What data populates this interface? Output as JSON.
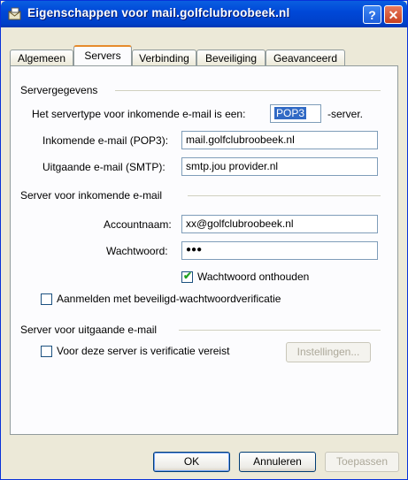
{
  "window": {
    "title": "Eigenschappen voor mail.golfclubroobeek.nl",
    "help_button": "?",
    "close_button": "✕"
  },
  "tabs": [
    {
      "label": "Algemeen",
      "active": false
    },
    {
      "label": "Servers",
      "active": true
    },
    {
      "label": "Verbinding",
      "active": false
    },
    {
      "label": "Beveiliging",
      "active": false
    },
    {
      "label": "Geavanceerd",
      "active": false
    }
  ],
  "server_info": {
    "group_title": "Servergegevens",
    "type_label_prefix": "Het servertype voor inkomende e-mail is een:",
    "type_value": "POP3",
    "type_label_suffix": "-server.",
    "incoming_label": "Inkomende e-mail (POP3):",
    "incoming_value": "mail.golfclubroobeek.nl",
    "outgoing_label": "Uitgaande e-mail (SMTP):",
    "outgoing_value": "smtp.jou provider.nl"
  },
  "incoming_server": {
    "group_title": "Server voor inkomende e-mail",
    "account_label": "Accountnaam:",
    "account_value": "xx@golfclubroobeek.nl",
    "password_label": "Wachtwoord:",
    "password_value": "●●●",
    "remember_label": "Wachtwoord onthouden",
    "remember_checked": true,
    "spa_label": "Aanmelden met beveiligd-wachtwoordverificatie",
    "spa_checked": false
  },
  "outgoing_server": {
    "group_title": "Server voor uitgaande e-mail",
    "auth_label": "Voor deze server is verificatie vereist",
    "auth_checked": false,
    "settings_button": "Instellingen..."
  },
  "buttons": {
    "ok": "OK",
    "cancel": "Annuleren",
    "apply": "Toepassen"
  }
}
